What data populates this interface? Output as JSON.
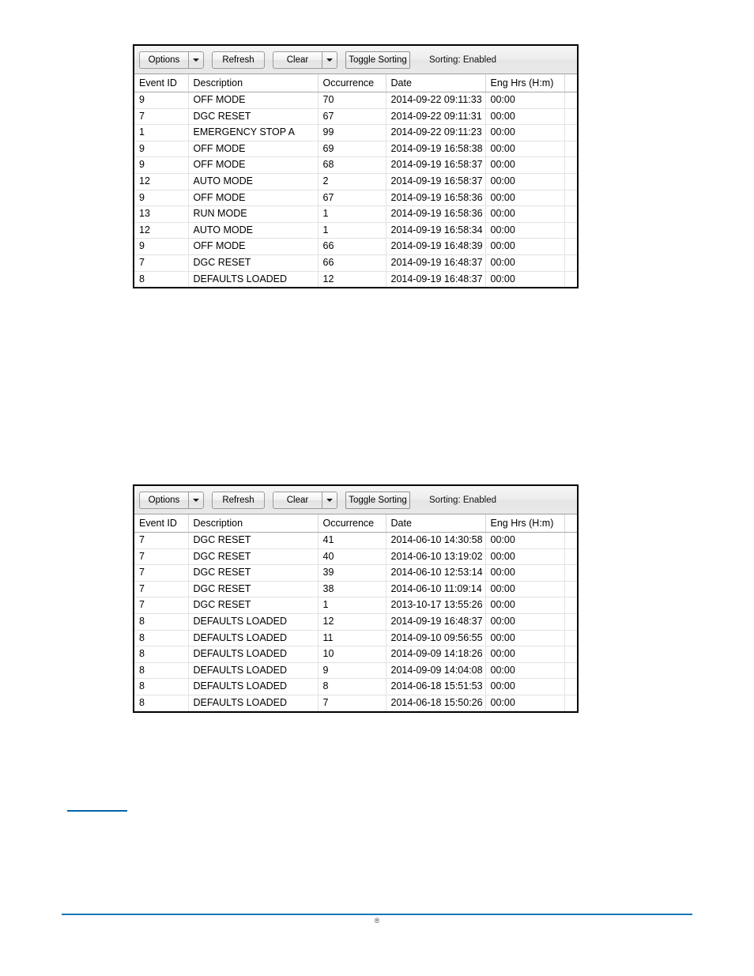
{
  "toolbar": {
    "options_label": "Options",
    "options_dropdown_icon": "chevron-down-icon",
    "refresh_label": "Refresh",
    "clear_label": "Clear",
    "clear_dropdown_icon": "chevron-down-icon",
    "toggle_sorting_label": "Toggle Sorting",
    "sorting_status": "Sorting: Enabled"
  },
  "columns": [
    "Event ID",
    "Description",
    "Occurrence",
    "Date",
    "Eng Hrs (H:m)",
    ""
  ],
  "table_one": {
    "rows": [
      {
        "event_id": "9",
        "description": "OFF MODE",
        "occurrence": "70",
        "date": "2014-09-22 09:11:33",
        "eng_hrs": "00:00"
      },
      {
        "event_id": "7",
        "description": "DGC RESET",
        "occurrence": "67",
        "date": "2014-09-22 09:11:31",
        "eng_hrs": "00:00"
      },
      {
        "event_id": "1",
        "description": "EMERGENCY STOP A",
        "occurrence": "99",
        "date": "2014-09-22 09:11:23",
        "eng_hrs": "00:00"
      },
      {
        "event_id": "9",
        "description": "OFF MODE",
        "occurrence": "69",
        "date": "2014-09-19 16:58:38",
        "eng_hrs": "00:00"
      },
      {
        "event_id": "9",
        "description": "OFF MODE",
        "occurrence": "68",
        "date": "2014-09-19 16:58:37",
        "eng_hrs": "00:00"
      },
      {
        "event_id": "12",
        "description": "AUTO MODE",
        "occurrence": "2",
        "date": "2014-09-19 16:58:37",
        "eng_hrs": "00:00"
      },
      {
        "event_id": "9",
        "description": "OFF MODE",
        "occurrence": "67",
        "date": "2014-09-19 16:58:36",
        "eng_hrs": "00:00"
      },
      {
        "event_id": "13",
        "description": "RUN MODE",
        "occurrence": "1",
        "date": "2014-09-19 16:58:36",
        "eng_hrs": "00:00"
      },
      {
        "event_id": "12",
        "description": "AUTO MODE",
        "occurrence": "1",
        "date": "2014-09-19 16:58:34",
        "eng_hrs": "00:00"
      },
      {
        "event_id": "9",
        "description": "OFF MODE",
        "occurrence": "66",
        "date": "2014-09-19 16:48:39",
        "eng_hrs": "00:00"
      },
      {
        "event_id": "7",
        "description": "DGC RESET",
        "occurrence": "66",
        "date": "2014-09-19 16:48:37",
        "eng_hrs": "00:00"
      },
      {
        "event_id": "8",
        "description": "DEFAULTS LOADED",
        "occurrence": "12",
        "date": "2014-09-19 16:48:37",
        "eng_hrs": "00:00"
      }
    ]
  },
  "table_two": {
    "rows": [
      {
        "event_id": "7",
        "description": "DGC RESET",
        "occurrence": "41",
        "date": "2014-06-10 14:30:58",
        "eng_hrs": "00:00"
      },
      {
        "event_id": "7",
        "description": "DGC RESET",
        "occurrence": "40",
        "date": "2014-06-10 13:19:02",
        "eng_hrs": "00:00"
      },
      {
        "event_id": "7",
        "description": "DGC RESET",
        "occurrence": "39",
        "date": "2014-06-10 12:53:14",
        "eng_hrs": "00:00"
      },
      {
        "event_id": "7",
        "description": "DGC RESET",
        "occurrence": "38",
        "date": "2014-06-10 11:09:14",
        "eng_hrs": "00:00"
      },
      {
        "event_id": "7",
        "description": "DGC RESET",
        "occurrence": "1",
        "date": "2013-10-17 13:55:26",
        "eng_hrs": "00:00"
      },
      {
        "event_id": "8",
        "description": "DEFAULTS LOADED",
        "occurrence": "12",
        "date": "2014-09-19 16:48:37",
        "eng_hrs": "00:00"
      },
      {
        "event_id": "8",
        "description": "DEFAULTS LOADED",
        "occurrence": "11",
        "date": "2014-09-10 09:56:55",
        "eng_hrs": "00:00"
      },
      {
        "event_id": "8",
        "description": "DEFAULTS LOADED",
        "occurrence": "10",
        "date": "2014-09-09 14:18:26",
        "eng_hrs": "00:00"
      },
      {
        "event_id": "8",
        "description": "DEFAULTS LOADED",
        "occurrence": "9",
        "date": "2014-09-09 14:04:08",
        "eng_hrs": "00:00"
      },
      {
        "event_id": "8",
        "description": "DEFAULTS LOADED",
        "occurrence": "8",
        "date": "2014-06-18 15:51:53",
        "eng_hrs": "00:00"
      },
      {
        "event_id": "8",
        "description": "DEFAULTS LOADED",
        "occurrence": "7",
        "date": "2014-06-18 15:50:26",
        "eng_hrs": "00:00"
      }
    ]
  },
  "page": {
    "footer_mark": "®"
  },
  "colors": {
    "footer_rule": "#1577bf",
    "link_rule": "#0464a8",
    "widget_border": "#000000"
  }
}
